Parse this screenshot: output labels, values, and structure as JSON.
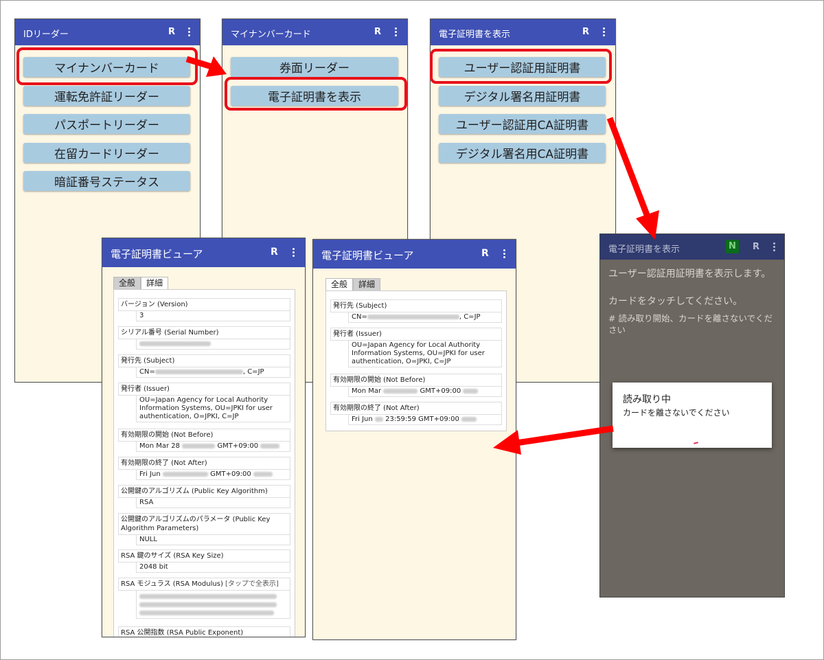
{
  "screens": {
    "idreader": {
      "title": "IDリーダー",
      "r": "R",
      "items": [
        "マイナンバーカード",
        "運転免許証リーダー",
        "パスポートリーダー",
        "在留カードリーダー",
        "暗証番号ステータス"
      ]
    },
    "mynumber": {
      "title": "マイナンバーカード",
      "r": "R",
      "items": [
        "券面リーダー",
        "電子証明書を表示"
      ]
    },
    "certs": {
      "title": "電子証明書を表示",
      "r": "R",
      "items": [
        "ユーザー認証用証明書",
        "デジタル署名用証明書",
        "ユーザー認証用CA証明書",
        "デジタル署名用CA証明書"
      ]
    },
    "viewer_detail": {
      "title": "電子証明書ビューア",
      "r": "R",
      "tab_general": "全般",
      "tab_detail": "詳細",
      "fields": [
        {
          "label": "バージョン (Version)",
          "value": "3"
        },
        {
          "label": "シリアル番号 (Serial Number)",
          "value": ""
        },
        {
          "label": "発行先 (Subject)",
          "value": "CN=",
          "suffix": ", C=JP"
        },
        {
          "label": "発行者 (Issuer)",
          "value": "OU=Japan Agency for Local Authority Information Systems, OU=JPKI for user authentication, O=JPKI, C=JP"
        },
        {
          "label": "有効期限の開始 (Not Before)",
          "value": "Mon Mar 28",
          "suffix": "GMT+09:00"
        },
        {
          "label": "有効期限の終了 (Not After)",
          "value": "Fri Jun",
          "suffix": "GMT+09:00"
        },
        {
          "label": "公開鍵のアルゴリズム (Public Key Algorithm)",
          "value": "RSA"
        },
        {
          "label": "公開鍵のアルゴリズムのパラメータ (Public Key Algorithm Parameters)",
          "value": "NULL"
        },
        {
          "label": "RSA 鍵のサイズ (RSA Key Size)",
          "value": "2048 bit"
        },
        {
          "label": "RSA モジュラス (RSA Modulus)",
          "hint": "[タップで全表示]",
          "value": ""
        },
        {
          "label": "RSA 公開指数 (RSA Public Exponent)",
          "value": ""
        }
      ]
    },
    "viewer_general": {
      "title": "電子証明書ビューア",
      "r": "R",
      "tab_general": "全般",
      "tab_detail": "詳細",
      "fields": [
        {
          "label": "発行先 (Subject)",
          "value": "CN=",
          "suffix": ", C=JP"
        },
        {
          "label": "発行者 (Issuer)",
          "value": "OU=Japan Agency for Local Authority Information Systems, OU=JPKI for user authentication, O=JPKI, C=JP"
        },
        {
          "label": "有効期限の開始 (Not Before)",
          "value": "Mon Mar",
          "suffix": "GMT+09:00"
        },
        {
          "label": "有効期限の終了 (Not After)",
          "value": "Fri Jun",
          "suffix": "23:59:59 GMT+09:00"
        }
      ]
    },
    "reading": {
      "title": "電子証明書を表示",
      "r": "R",
      "nfc": "N",
      "message1": "ユーザー認証用証明書を表示します。",
      "message2": "カードをタッチしてください。",
      "message3": "# 読み取り開始、カードを離さないでください",
      "dialog_title": "読み取り中",
      "dialog_message": "カードを離さないでください"
    }
  },
  "colors": {
    "appbar": "#3f51b5",
    "button": "#a9cbe0",
    "highlight": "#e8101a",
    "arrow": "#ff0000",
    "screen_bg": "#fdf7e4",
    "dark_bg": "#6c6760"
  }
}
